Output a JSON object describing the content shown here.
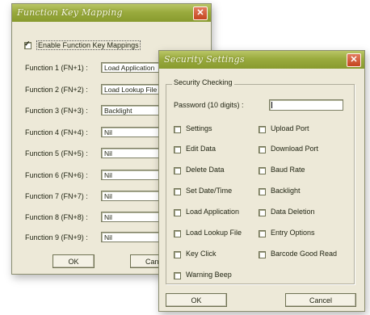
{
  "mapping_dialog": {
    "title": "Function Key Mapping",
    "close_label": "✕",
    "enable_label": "Enable Function Key Mappings",
    "functions": [
      {
        "label": "Function 1 (FN+1) :",
        "value": "Load Application"
      },
      {
        "label": "Function 2 (FN+2) :",
        "value": "Load Lookup File"
      },
      {
        "label": "Function 3 (FN+3) :",
        "value": "Backlight"
      },
      {
        "label": "Function 4 (FN+4) :",
        "value": "Nil"
      },
      {
        "label": "Function 5 (FN+5) :",
        "value": "Nil"
      },
      {
        "label": "Function 6 (FN+6) :",
        "value": "Nil"
      },
      {
        "label": "Function 7 (FN+7) :",
        "value": "Nil"
      },
      {
        "label": "Function 8 (FN+8) :",
        "value": "Nil"
      },
      {
        "label": "Function 9 (FN+9) :",
        "value": "Nil"
      }
    ],
    "ok_label": "OK",
    "cancel_label": "Cancel"
  },
  "security_dialog": {
    "title": "Security Settings",
    "close_label": "✕",
    "group_label": "Security Checking",
    "password_label": "Password (10 digits) :",
    "password_value": "",
    "left_options": [
      "Settings",
      "Edit Data",
      "Delete Data",
      "Set Date/Time",
      "Load Application",
      "Load Lookup File",
      "Key Click",
      "Warning Beep"
    ],
    "right_options": [
      "Upload Port",
      "Download Port",
      "Baud Rate",
      "Backlight",
      "Data Deletion",
      "Entry Options",
      "Barcode Good Read"
    ],
    "ok_label": "OK",
    "cancel_label": "Cancel"
  },
  "colors": {
    "titlebar": "#9aab3e",
    "dialog_bg": "#ede9d8",
    "close_button": "#c4451f"
  }
}
